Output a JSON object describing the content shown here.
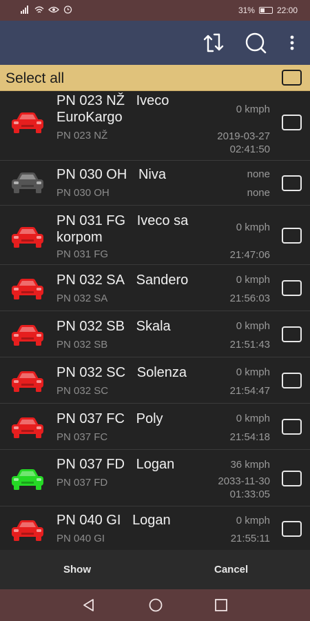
{
  "status": {
    "battery": "31%",
    "time": "22:00"
  },
  "appbar": {
    "icons": [
      "sync-icon",
      "search-icon",
      "overflow-menu-icon"
    ]
  },
  "select_all": {
    "label": "Select all",
    "checked": false
  },
  "vehicles": [
    {
      "plate": "PN 023 NŽ",
      "model": "Iveco EuroKargo",
      "sub": "PN 023 NŽ",
      "speed": "0 kmph",
      "time": "2019-03-27\n02:41:50",
      "color": "#e61e1e",
      "checked": false
    },
    {
      "plate": "PN 030 OH",
      "model": "Niva",
      "sub": "PN 030 OH",
      "speed": "none",
      "time": "none",
      "color": "#555555",
      "checked": false
    },
    {
      "plate": "PN 031 FG",
      "model": "Iveco sa korpom",
      "sub": "PN 031 FG",
      "speed": "0 kmph",
      "time": "21:47:06",
      "color": "#e61e1e",
      "checked": false
    },
    {
      "plate": "PN 032 SA",
      "model": "Sandero",
      "sub": "PN 032 SA",
      "speed": "0 kmph",
      "time": "21:56:03",
      "color": "#e61e1e",
      "checked": false
    },
    {
      "plate": "PN 032 SB",
      "model": "Skala",
      "sub": "PN 032 SB",
      "speed": "0 kmph",
      "time": "21:51:43",
      "color": "#e61e1e",
      "checked": false
    },
    {
      "plate": "PN 032 SC",
      "model": "Solenza",
      "sub": "PN 032 SC",
      "speed": "0 kmph",
      "time": "21:54:47",
      "color": "#e61e1e",
      "checked": false
    },
    {
      "plate": "PN 037 FC",
      "model": "Poly",
      "sub": "PN 037 FC",
      "speed": "0 kmph",
      "time": "21:54:18",
      "color": "#e61e1e",
      "checked": false
    },
    {
      "plate": "PN 037 FD",
      "model": "Logan",
      "sub": "PN 037 FD",
      "speed": "36 kmph",
      "time": "2033-11-30\n01:33:05",
      "color": "#25d925",
      "checked": false
    },
    {
      "plate": "PN 040 GI",
      "model": "Logan",
      "sub": "PN 040 GI",
      "speed": "0 kmph",
      "time": "21:55:11",
      "color": "#e61e1e",
      "checked": false
    }
  ],
  "footer": {
    "show_label": "Show",
    "cancel_label": "Cancel"
  },
  "navbar": {
    "icons": [
      "back-icon",
      "home-icon",
      "recents-icon"
    ]
  }
}
